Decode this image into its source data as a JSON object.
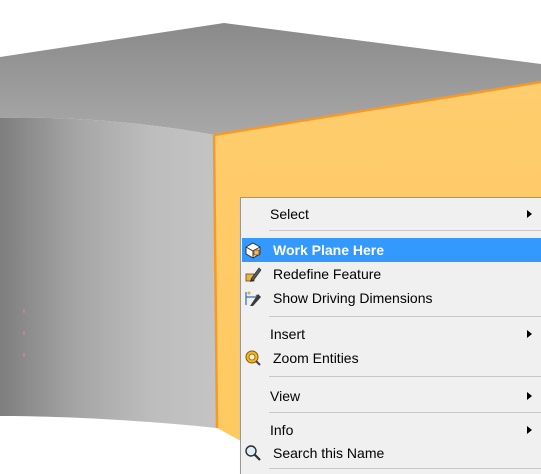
{
  "colors": {
    "model_top": "#8c8c8c",
    "model_side": "#a9a9a9",
    "selected_face": "#ffcc66",
    "selected_edge": "#ff9933",
    "menu_background": "#f0f0f0",
    "menu_highlight": "#3399ff"
  },
  "context_menu": {
    "items": [
      {
        "label": "Select",
        "icon": null,
        "submenu": true
      },
      {
        "label": "Work Plane Here",
        "icon": "work-plane-icon",
        "submenu": false,
        "highlighted": true
      },
      {
        "label": "Redefine Feature",
        "icon": "redefine-feature-icon",
        "submenu": false
      },
      {
        "label": "Show Driving Dimensions",
        "icon": "show-dimensions-icon",
        "submenu": false
      },
      {
        "label": "Insert",
        "icon": null,
        "submenu": true
      },
      {
        "label": "Zoom Entities",
        "icon": "zoom-entities-icon",
        "submenu": false
      },
      {
        "label": "View",
        "icon": null,
        "submenu": true
      },
      {
        "label": "Info",
        "icon": null,
        "submenu": true
      },
      {
        "label": "Search this Name",
        "icon": "search-icon",
        "submenu": false
      }
    ]
  }
}
